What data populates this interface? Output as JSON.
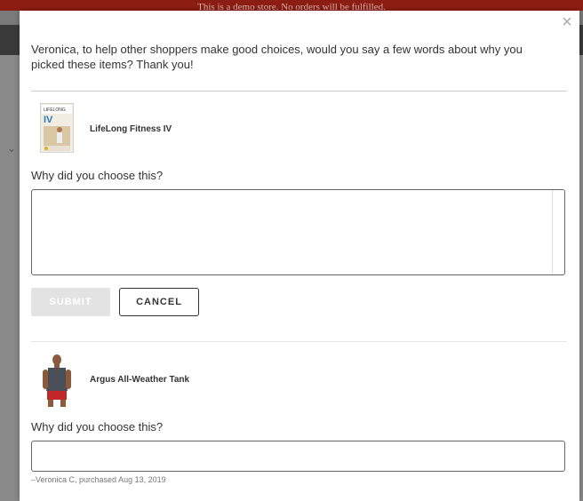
{
  "background": {
    "notice_text": "This is a demo store. No orders will be fulfilled."
  },
  "modal": {
    "close_icon": "close-icon",
    "intro_text": "Veronica, to help other shoppers make good choices, would you say a few words about why you picked these items? Thank you!",
    "products": [
      {
        "name": "LifeLong Fitness IV",
        "question": "Why did you choose this?",
        "answer_value": ""
      },
      {
        "name": "Argus All-Weather Tank",
        "question": "Why did you choose this?",
        "answer_value": ""
      }
    ],
    "submit_label": "SUBMIT",
    "cancel_label": "CANCEL",
    "attribution": "–Veronica C, purchased Aug 13, 2019"
  },
  "colors": {
    "brand_red": "#8c1d12",
    "submit_disabled": "#e3e3e3"
  }
}
